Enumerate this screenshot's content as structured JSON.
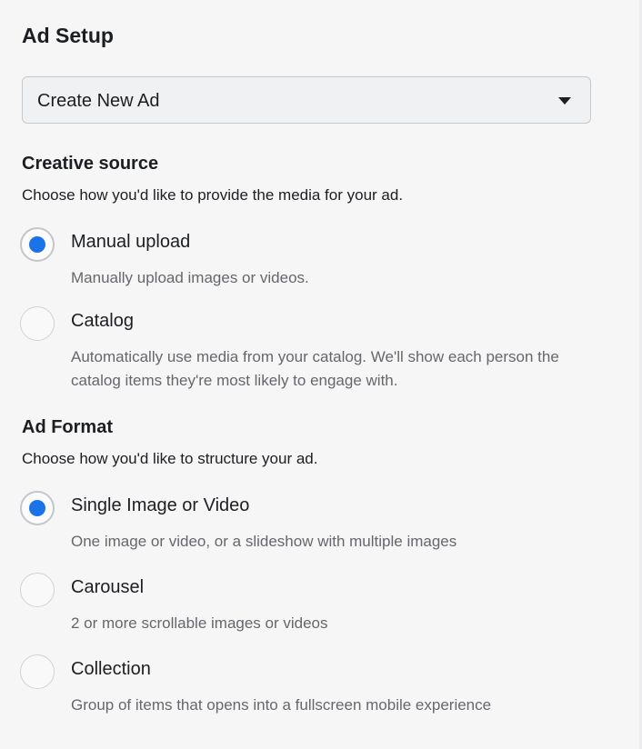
{
  "ad_setup": {
    "title": "Ad Setup",
    "dropdown": {
      "selected": "Create New Ad"
    }
  },
  "creative_source": {
    "title": "Creative source",
    "description": "Choose how you'd like to provide the media for your ad.",
    "options": [
      {
        "label": "Manual upload",
        "description": "Manually upload images or videos.",
        "selected": true
      },
      {
        "label": "Catalog",
        "description": "Automatically use media from your catalog. We'll show each person the catalog items they're most likely to engage with.",
        "selected": false
      }
    ]
  },
  "ad_format": {
    "title": "Ad Format",
    "description": "Choose how you'd like to structure your ad.",
    "options": [
      {
        "label": "Single Image or Video",
        "description": "One image or video, or a slideshow with multiple images",
        "selected": true
      },
      {
        "label": "Carousel",
        "description": "2 or more scrollable images or videos",
        "selected": false
      },
      {
        "label": "Collection",
        "description": "Group of items that opens into a fullscreen mobile experience",
        "selected": false
      }
    ]
  },
  "colors": {
    "accent": "#1a73e8",
    "text_primary": "#1c1e21",
    "text_secondary": "#65676b",
    "background": "#f6f6f7"
  }
}
